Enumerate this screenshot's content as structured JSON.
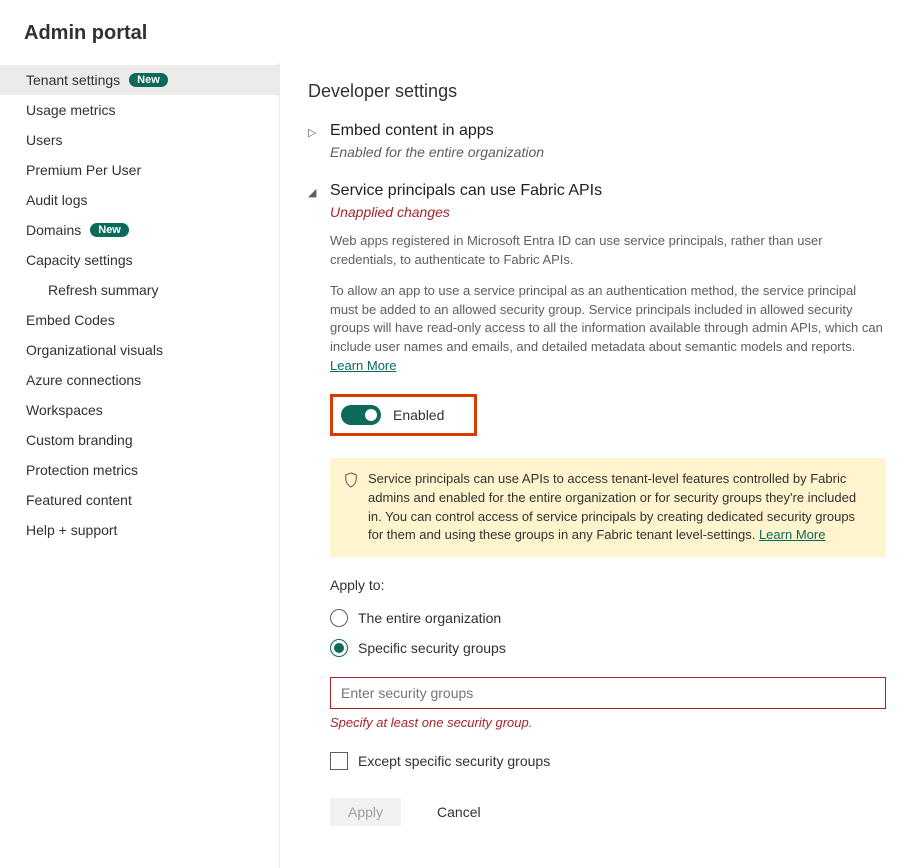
{
  "page_title": "Admin portal",
  "sidebar": {
    "items": [
      {
        "label": "Tenant settings",
        "badge": "New",
        "active": true
      },
      {
        "label": "Usage metrics"
      },
      {
        "label": "Users"
      },
      {
        "label": "Premium Per User"
      },
      {
        "label": "Audit logs"
      },
      {
        "label": "Domains",
        "badge": "New"
      },
      {
        "label": "Capacity settings"
      },
      {
        "label": "Refresh summary",
        "sub": true
      },
      {
        "label": "Embed Codes"
      },
      {
        "label": "Organizational visuals"
      },
      {
        "label": "Azure connections"
      },
      {
        "label": "Workspaces"
      },
      {
        "label": "Custom branding"
      },
      {
        "label": "Protection metrics"
      },
      {
        "label": "Featured content"
      },
      {
        "label": "Help + support"
      }
    ]
  },
  "content": {
    "section_title": "Developer settings",
    "setting_embed": {
      "title": "Embed content in apps",
      "subtitle": "Enabled for the entire organization"
    },
    "setting_sp": {
      "title": "Service principals can use Fabric APIs",
      "subtitle": "Unapplied changes",
      "desc1": "Web apps registered in Microsoft Entra ID can use service principals, rather than user credentials, to authenticate to Fabric APIs.",
      "desc2": "To allow an app to use a service principal as an authentication method, the service principal must be added to an allowed security group. Service principals included in allowed security groups will have read-only access to all the information available through admin APIs, which can include user names and emails, and detailed metadata about semantic models and reports. ",
      "learn_more": "Learn More",
      "toggle_label": "Enabled",
      "info_text": "Service principals can use APIs to access tenant-level features controlled by Fabric admins and enabled for the entire organization or for security groups they're included in. You can control access of service principals by creating dedicated security groups for them and using these groups in any Fabric tenant level-settings. ",
      "apply_to_label": "Apply to:",
      "radio_entire": "The entire organization",
      "radio_specific": "Specific security groups",
      "input_placeholder": "Enter security groups",
      "error_text": "Specify at least one security group.",
      "except_label": "Except specific security groups",
      "btn_apply": "Apply",
      "btn_cancel": "Cancel"
    }
  }
}
